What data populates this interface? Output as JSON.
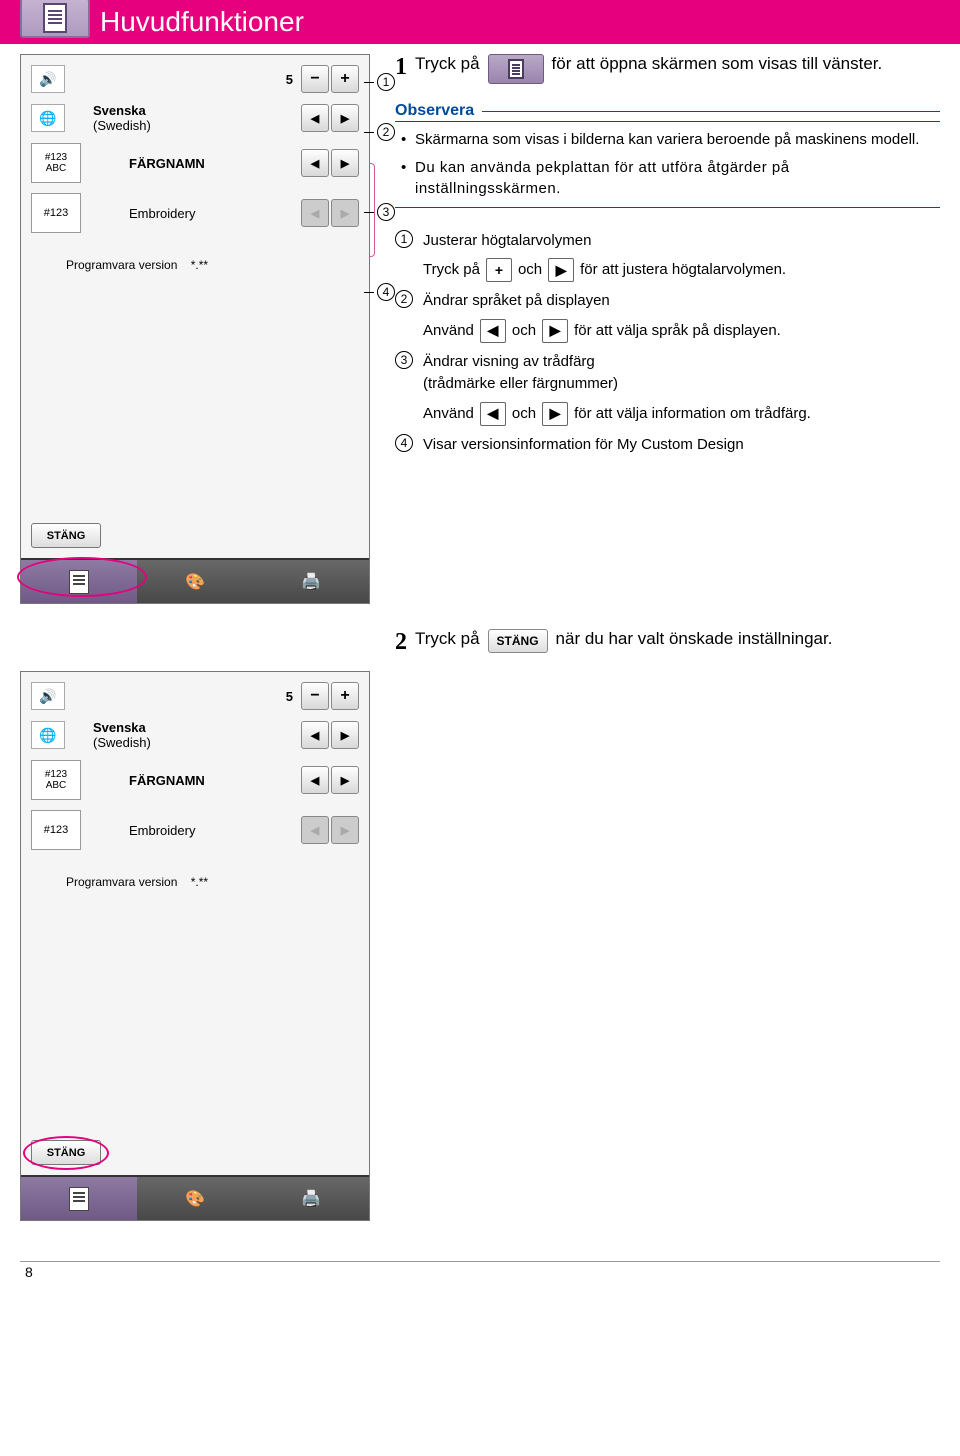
{
  "header": {
    "title": "Huvudfunktioner"
  },
  "step1": {
    "num": "1",
    "pre": "Tryck på",
    "post": "för att öppna skärmen som visas till vänster."
  },
  "note": {
    "title": "Observera",
    "items": [
      "Skärmarna som visas i bilderna kan variera beroende på maskinens modell.",
      "Du kan använda pekplattan för att utföra åtgärder på inställningsskärmen."
    ]
  },
  "callouts": {
    "c1": {
      "title": "Justerar högtalarvolymen",
      "sub_pre": "Tryck på",
      "sub_mid": "och",
      "sub_post": "för att justera högtalarvolymen."
    },
    "c2": {
      "title": "Ändrar språket på displayen",
      "sub_pre": "Använd",
      "sub_mid": "och",
      "sub_post": "för att välja språk på displayen."
    },
    "c3": {
      "title": "Ändrar visning av trådfärg",
      "subtitle": "(trådmärke eller färgnummer)",
      "sub_pre": "Använd",
      "sub_mid": "och",
      "sub_post": "för att välja information om trådfärg."
    },
    "c4": {
      "title": "Visar versionsinformation för My Custom Design"
    }
  },
  "screenshot": {
    "volume_value": "5",
    "language_label": "Svenska",
    "language_sub": "(Swedish)",
    "row3_icon": "#123\nABC",
    "row3_label": "FÄRGNAMN",
    "row4_icon": "#123",
    "row4_label": "Embroidery",
    "version_label": "Programvara version",
    "version_value": "*.**",
    "close": "STÄNG"
  },
  "step2": {
    "num": "2",
    "pre": "Tryck på",
    "btn": "STÄNG",
    "post": "när du har valt önskade inställningar."
  },
  "page_num": "8"
}
